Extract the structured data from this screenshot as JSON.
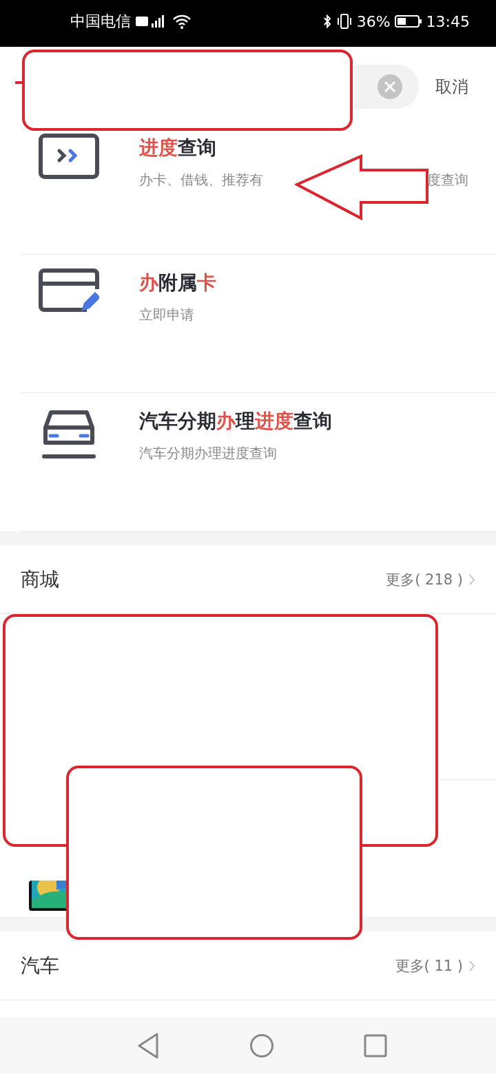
{
  "status_bar": {
    "carrier": "中国电信",
    "battery": "36%",
    "time": "13:45"
  },
  "search": {
    "cancel": "取消"
  },
  "results": [
    {
      "kind": "progress",
      "title": "**进度**查询",
      "subtitle_start": "办卡、借钱、推荐有",
      "subtitle_end": "度查询"
    },
    {
      "kind": "card",
      "title": "**办**附属**卡**",
      "subtitle_start": "立即申请"
    },
    {
      "kind": "car",
      "title": "汽车分期**办**理**进度**查询",
      "subtitle_start": "汽车分期办理进度查询"
    }
  ],
  "sections": [
    {
      "title": "商城",
      "more": "更多( 218 )",
      "items": [
        {
          "kind": "hidden"
        },
        {
          "kind": "picture"
        }
      ]
    },
    {
      "title": "汽车",
      "more": "更多( 11 )"
    }
  ],
  "annotations": [
    {
      "kind": "tick"
    },
    {
      "kind": "box"
    },
    {
      "kind": "arrow"
    },
    {
      "kind": "box"
    },
    {
      "kind": "box"
    }
  ]
}
